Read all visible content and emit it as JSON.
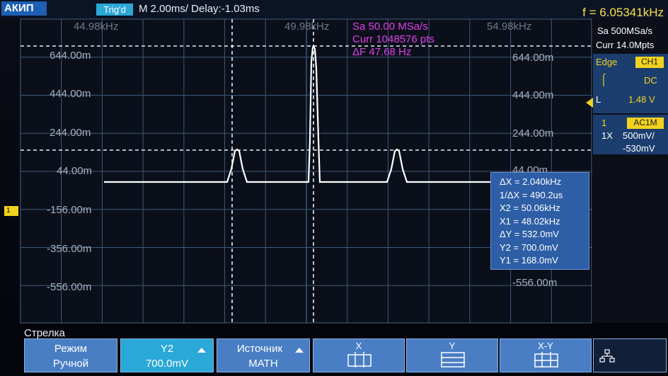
{
  "topbar": {
    "brand": "АКИП",
    "trig_status": "Trig'd",
    "timebase": "M 2.00ms/ Delay:-1.03ms",
    "frequency": "f = 6.05341kHz"
  },
  "grid": {
    "x_labels": [
      "44.98kHz",
      "49.98kHz",
      "54.98kHz"
    ],
    "y_labels_left": [
      "644.00m",
      "444.00m",
      "244.00m",
      "44.00m",
      "-156.00m",
      "-356.00m",
      "-556.00m"
    ],
    "y_labels_right": [
      "644.00m",
      "444.00m",
      "244.00m",
      "44.00m",
      "-556.00m"
    ]
  },
  "math_info": {
    "sample_rate": "Sa 50.00 MSa/s",
    "points": "Curr 1048576 pts",
    "resolution": "ΔF 47.68 Hz"
  },
  "readout": {
    "dx": "ΔX = 2.040kHz",
    "inv_dx": "1/ΔX = 490.2us",
    "x2": "X2 = 50.06kHz",
    "x1": "X1 = 48.02kHz",
    "dy": "ΔY = 532.0mV",
    "y2": "Y2 = 700.0mV",
    "y1": "Y1 = 168.0mV"
  },
  "right_panel": {
    "sample_rate": "Sa 500MSa/s",
    "memory": "Curr 14.0Mpts",
    "trigger_type": "Edge",
    "trigger_source": "CH1",
    "coupling": "DC",
    "level_label": "L",
    "level_value": "1.48 V",
    "channel_num": "1",
    "channel_coupling": "AC1M",
    "probe": "1X",
    "volts_div": "500mV/",
    "offset": "-530mV"
  },
  "menu": {
    "title": "Стрелка",
    "buttons": [
      {
        "line1": "Режим",
        "line2": "Ручной"
      },
      {
        "line1": "Y2",
        "line2": "700.0mV"
      },
      {
        "line1": "Источник",
        "line2": "MATH"
      },
      {
        "line1": "X",
        "line2": ""
      },
      {
        "line1": "Y",
        "line2": ""
      },
      {
        "line1": "X-Y",
        "line2": ""
      },
      {
        "line1": "",
        "line2": ""
      }
    ]
  },
  "channel_marker": "1",
  "colors": {
    "trace": "#ffffff",
    "grid": "#3c5a78",
    "magenta": "#e040e8",
    "accent": "#2aa8d8",
    "yellow": "#f2d21e"
  }
}
